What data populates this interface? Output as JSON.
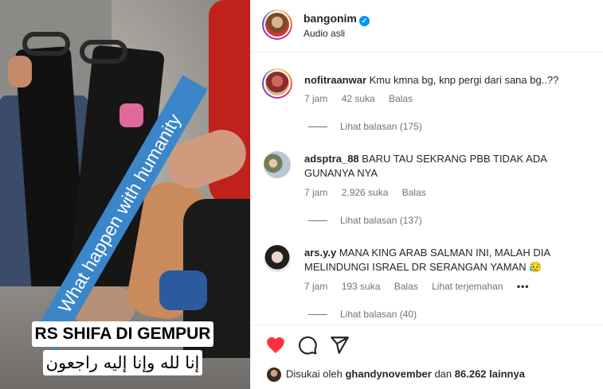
{
  "video": {
    "banner_text": "What happen with humanity",
    "caption_line1": "RS SHIFA DI GEMPUR",
    "caption_line2": "إنا لله وإنا إليه راجعون"
  },
  "post": {
    "username": "bangonim",
    "subtitle": "Audio asli",
    "verified_icon": "verified-badge-icon"
  },
  "comments": [
    {
      "username": "nofitraanwar",
      "text": "Kmu kmna bg, knp pergi dari sana bg..??",
      "time": "7 jam",
      "likes": "42 suka",
      "reply": "Balas",
      "view_replies": "Lihat balasan (175)"
    },
    {
      "username": "adsptra_88",
      "text": "BARU TAU SEKRANG PBB TIDAK ADA GUNANYA NYA",
      "time": "7 jam",
      "likes": "2,926 suka",
      "reply": "Balas",
      "view_replies": "Lihat balasan (137)"
    },
    {
      "username": "ars.y.y",
      "text": "MANA KING ARAB SALMAN INI, MALAH DIA MELINDUNGI ISRAEL DR SERANGAN YAMAN 😥",
      "time": "7 jam",
      "likes": "193 suka",
      "reply": "Balas",
      "translate": "Lihat terjemahan",
      "more": "•••",
      "view_replies": "Lihat balasan (40)"
    }
  ],
  "actions": {
    "like_icon": "heart-icon",
    "comment_icon": "comment-icon",
    "share_icon": "share-icon",
    "like_color": "#ff3040"
  },
  "liked_by": {
    "prefix": "Disukai oleh",
    "user": "ghandynovember",
    "and": "dan",
    "count": "86.262 lainnya"
  }
}
